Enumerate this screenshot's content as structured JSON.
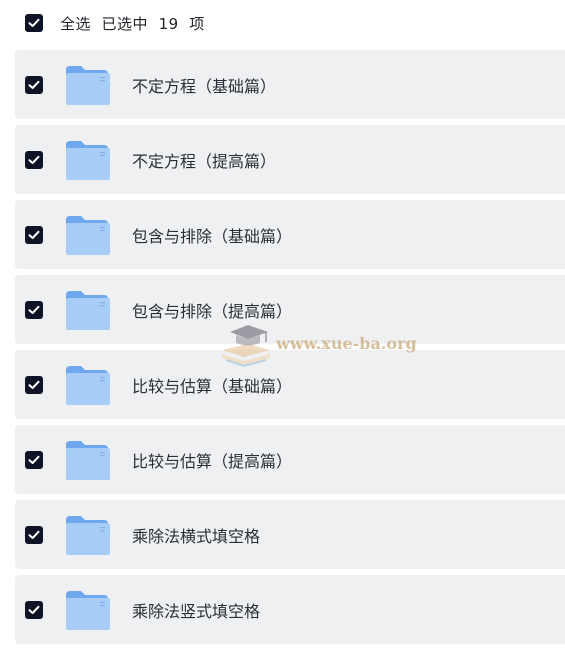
{
  "header": {
    "select_all_label": "全选  已选中  19  项",
    "select_all_checked": true
  },
  "items": [
    {
      "name": "不定方程（基础篇）",
      "checked": true,
      "icon": "folder-icon"
    },
    {
      "name": "不定方程（提高篇）",
      "checked": true,
      "icon": "folder-icon"
    },
    {
      "name": "包含与排除（基础篇）",
      "checked": true,
      "icon": "folder-icon"
    },
    {
      "name": "包含与排除（提高篇）",
      "checked": true,
      "icon": "folder-icon"
    },
    {
      "name": "比较与估算（基础篇）",
      "checked": true,
      "icon": "folder-icon"
    },
    {
      "name": "比较与估算（提高篇）",
      "checked": true,
      "icon": "folder-icon"
    },
    {
      "name": "乘除法横式填空格",
      "checked": true,
      "icon": "folder-icon"
    },
    {
      "name": "乘除法竖式填空格",
      "checked": true,
      "icon": "folder-icon"
    }
  ],
  "watermark": {
    "text": "www.xue-ba.org",
    "icon": "graduation-cap-books-logo"
  },
  "colors": {
    "checkbox": "#0f1326",
    "row_background": "#eff0f2",
    "folder_light": "#a8cdf7",
    "folder_dark": "#6fa8ee"
  }
}
